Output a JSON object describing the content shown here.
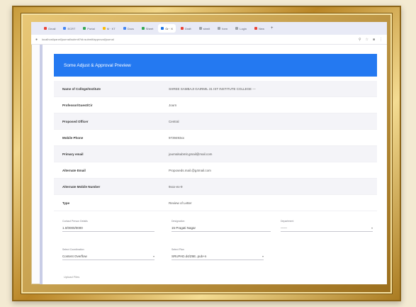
{
  "browser": {
    "tabs": [
      {
        "label": "Gmail",
        "color": "#ea4335"
      },
      {
        "label": "ECRT",
        "color": "#4285f4"
      },
      {
        "label": "Portal",
        "color": "#34a853"
      },
      {
        "label": "M · KT",
        "color": "#fbbc05"
      },
      {
        "label": "Docs",
        "color": "#4285f4"
      },
      {
        "label": "Sheet",
        "color": "#34a853"
      },
      {
        "label": "Gr · X",
        "color": "#1a73e8",
        "active": true
      },
      {
        "label": "Draft",
        "color": "#ea4335"
      },
      {
        "label": "sbmit",
        "color": "#9aa0a6"
      },
      {
        "label": "form",
        "color": "#9aa0a6"
      },
      {
        "label": "Login",
        "color": "#9aa0a6"
      },
      {
        "label": "New",
        "color": "#ea4335"
      }
    ],
    "new_tab_label": "+",
    "address": "localhost/panel/journal/submit?id=submit/approval/journal",
    "toolbar_icons": [
      "zoom-icon",
      "star-icon",
      "extensions-icon",
      "menu-icon"
    ]
  },
  "banner": {
    "title": "Some Adjust & Approval Preview"
  },
  "details": [
    {
      "label": "Name of College/Institute",
      "value": "SHREE SAMBAJI GAIRMIL 31 IST INSTITUTE COLLEGE ---"
    },
    {
      "label": "Professor/Guest/Cir",
      "value": "Journ"
    },
    {
      "label": "Proposed Officer",
      "value": "Central"
    },
    {
      "label": "Mobile Phone",
      "value": "9739493xx"
    },
    {
      "label": "Primary email",
      "value": "journalsubmit.gmail@mail.com"
    },
    {
      "label": "Alternate Email",
      "value": "Proposeds.mail.@g4mail.com"
    },
    {
      "label": "Alternate Mobile Number",
      "value": "9xxx-ex-9"
    },
    {
      "label": "Type",
      "value": "Review of Letter"
    }
  ],
  "form_row1": [
    {
      "label": "Contact Person Details",
      "value": "1.0/0000/0000"
    },
    {
      "label": "Designation",
      "value": "15 Pragati Nagar"
    },
    {
      "label": "Department",
      "value": "------"
    }
  ],
  "form_row2": [
    {
      "label": "Select Coordination",
      "value": "Content Overflow"
    },
    {
      "label": "Select Plan",
      "value": "SRUPAD.d4/Z6E..pub+n"
    }
  ],
  "partial_label": "Upload Files"
}
